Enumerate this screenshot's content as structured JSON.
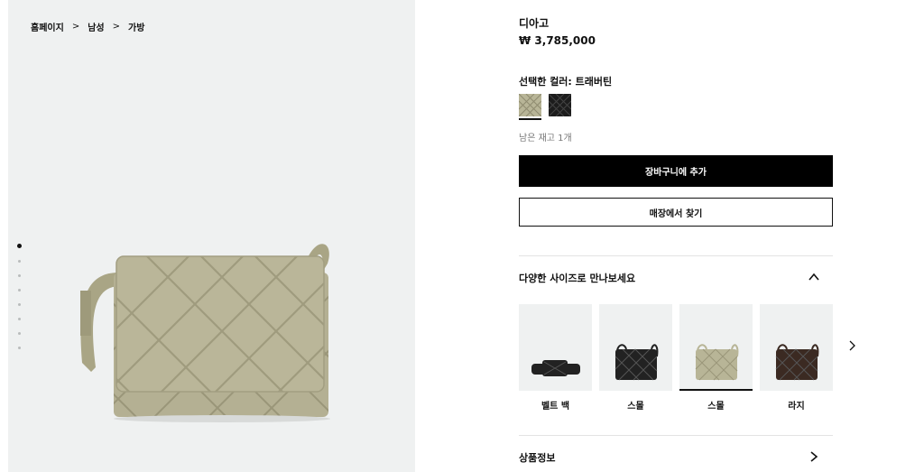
{
  "breadcrumb": {
    "home": "홈페이지",
    "men": "남성",
    "bags": "가방",
    "separator": ">"
  },
  "gallery": {
    "dot_count": 8,
    "active_index": 0,
    "background": "#eff1f1",
    "product_color": "#b9b596"
  },
  "product": {
    "name": "디아고",
    "price": "₩ 3,785,000",
    "color_label": "선택한 컬러: 트래버틴",
    "swatches": [
      {
        "name": "트래버틴",
        "color": "#b8b597",
        "selected": true
      },
      {
        "name": "블랙",
        "color": "#1c1c1c",
        "selected": false
      }
    ],
    "stock": "남은 재고 1개"
  },
  "actions": {
    "add_to_cart": "장바구니에 추가",
    "find_in_store": "매장에서 찾기"
  },
  "sizes_section": {
    "title": "다양한 사이즈로 만나보세요",
    "items": [
      {
        "label": "벨트 백",
        "color": "#222222",
        "shape": "belt"
      },
      {
        "label": "스몰",
        "color": "#222222",
        "shape": "bag"
      },
      {
        "label": "스몰",
        "color": "#b8b597",
        "shape": "bag",
        "selected": true
      },
      {
        "label": "라지",
        "color": "#3b2a22",
        "shape": "bag"
      }
    ]
  },
  "info_section": {
    "title": "상품정보"
  }
}
